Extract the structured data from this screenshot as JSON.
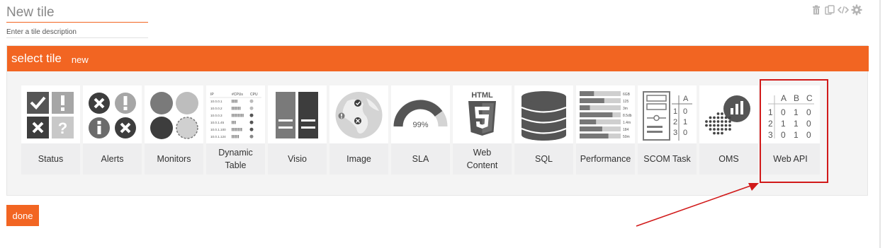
{
  "header": {
    "title_placeholder": "New tile",
    "description_placeholder": "Enter a tile description"
  },
  "toolbar": {
    "icons": [
      "trash-icon",
      "duplicate-icon",
      "code-icon",
      "gear-icon"
    ]
  },
  "panel": {
    "title": "select tile",
    "new_label": "new"
  },
  "tiles": [
    {
      "label": "Status",
      "icon": "status-icon"
    },
    {
      "label": "Alerts",
      "icon": "alerts-icon"
    },
    {
      "label": "Monitors",
      "icon": "monitors-icon"
    },
    {
      "label": "Dynamic Table",
      "icon": "dynamic-table-icon"
    },
    {
      "label": "Visio",
      "icon": "visio-icon"
    },
    {
      "label": "Image",
      "icon": "image-icon"
    },
    {
      "label": "SLA",
      "icon": "sla-icon",
      "value": "99%"
    },
    {
      "label": "Web Content",
      "icon": "html5-icon"
    },
    {
      "label": "SQL",
      "icon": "sql-icon"
    },
    {
      "label": "Performance",
      "icon": "performance-icon"
    },
    {
      "label": "SCOM Task",
      "icon": "scom-task-icon"
    },
    {
      "label": "OMS",
      "icon": "oms-icon"
    },
    {
      "label": "Web API",
      "icon": "web-api-icon"
    }
  ],
  "dynamic_table_preview": {
    "headers": [
      "IP",
      "#CPUs",
      "CPU"
    ],
    "rows": [
      "10.0.0.1",
      "10.0.0.2",
      "10.0.0.3",
      "10.0.1.45",
      "10.0.1.100",
      "10.0.1.124"
    ]
  },
  "performance_preview": {
    "values": [
      "6GB",
      "125",
      "3m",
      "8.5db",
      "1.4m",
      "184",
      "50m"
    ]
  },
  "scom_preview": {
    "header": "A",
    "rows": [
      [
        "1",
        "0"
      ],
      [
        "2",
        "1"
      ],
      [
        "3",
        "0"
      ]
    ]
  },
  "web_api_preview": {
    "headers": [
      "A",
      "B",
      "C"
    ],
    "rows": [
      [
        "1",
        "0",
        "1",
        "0"
      ],
      [
        "2",
        "1",
        "1",
        "0"
      ],
      [
        "3",
        "0",
        "1",
        "0"
      ]
    ]
  },
  "colors": {
    "accent": "#f26522",
    "icon_dark": "#555555",
    "icon_light": "#a6a6a6",
    "annotation_red": "#d11a1a"
  },
  "done_label": "done"
}
